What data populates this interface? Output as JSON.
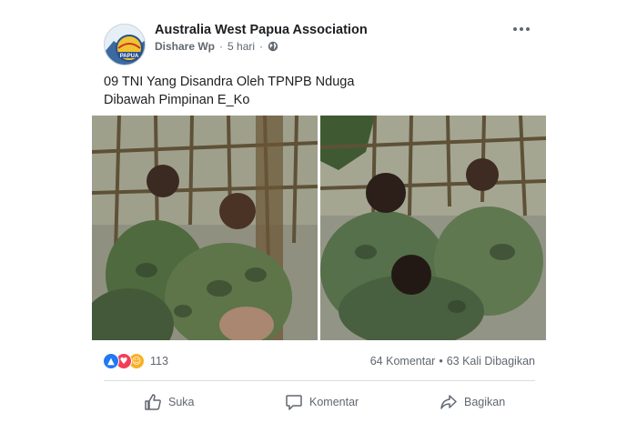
{
  "post": {
    "page_name": "Australia West Papua Association",
    "shared_by": "Dishare Wp",
    "time": "5 hari",
    "separator": "·",
    "avatar_text": "PAPUA",
    "caption_line1": "09 TNI Yang Disandra Oleh TPNPB Nduga",
    "caption_line2": "Dibawah Pimpinan E_Ko"
  },
  "photos": [
    {
      "description_icon": "photo-soldiers-left"
    },
    {
      "description_icon": "photo-soldiers-right"
    }
  ],
  "engagement": {
    "reaction_count": "113",
    "comments": "64 Komentar",
    "shares": "63 Kali Dibagikan",
    "separator": "•",
    "reactions": [
      "like",
      "love",
      "haha"
    ]
  },
  "actions": {
    "like": "Suka",
    "comment": "Komentar",
    "share": "Bagikan"
  },
  "colors": {
    "like_blue": "#2078f4",
    "love_red": "#f33e58",
    "haha_yellow": "#f7b125",
    "text_secondary": "#606770"
  }
}
